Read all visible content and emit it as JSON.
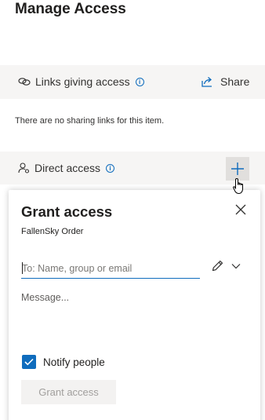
{
  "page": {
    "title": "Manage Access"
  },
  "links_section": {
    "label": "Links giving access",
    "share_label": "Share",
    "empty_text": "There are no sharing links for this item."
  },
  "direct_section": {
    "label": "Direct access"
  },
  "grant_panel": {
    "title": "Grant access",
    "subtitle": "FallenSky Order",
    "to_placeholder": "To: Name, group or email",
    "to_value": "",
    "message_placeholder": "Message...",
    "notify_label": "Notify people",
    "notify_checked": true,
    "grant_button_label": "Grant access",
    "grant_button_enabled": false
  },
  "icons": {
    "links": "link-icon",
    "info": "info-icon",
    "share": "share-icon",
    "direct": "person-settings-icon",
    "add": "plus-icon",
    "close": "close-icon",
    "permission": "pencil-icon",
    "dropdown": "chevron-down-icon",
    "check": "checkmark-icon"
  },
  "colors": {
    "accent": "#0f6cbd",
    "band_background": "#f6f5f4",
    "disabled_button": "#f3f2f1"
  }
}
